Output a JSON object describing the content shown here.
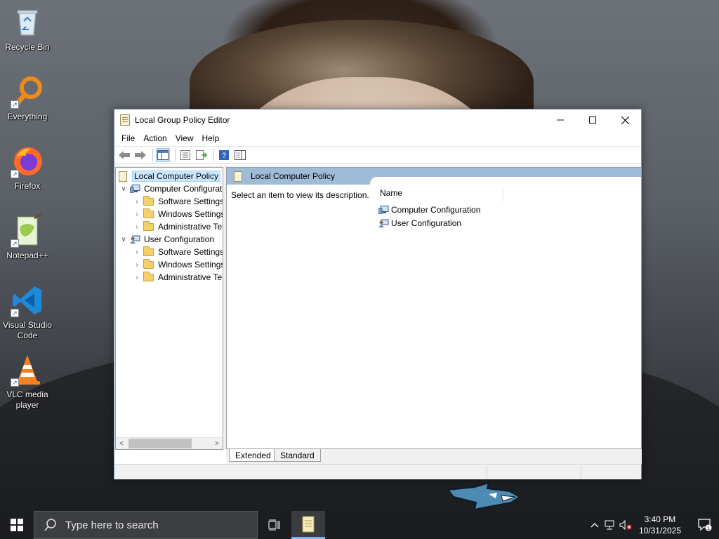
{
  "desktop": {
    "icons": [
      {
        "label": "Recycle Bin",
        "icon": "recycle-bin-icon"
      },
      {
        "label": "Everything",
        "icon": "everything-search-icon"
      },
      {
        "label": "Firefox",
        "icon": "firefox-icon"
      },
      {
        "label": "Notepad++",
        "icon": "notepad-plus-plus-icon"
      },
      {
        "label": "Visual Studio Code",
        "icon": "vscode-icon"
      },
      {
        "label": "VLC media player",
        "icon": "vlc-icon"
      }
    ]
  },
  "window": {
    "title": "Local Group Policy Editor",
    "menu": [
      "File",
      "Action",
      "View",
      "Help"
    ],
    "tree": {
      "root": "Local Computer Policy",
      "computer": "Computer Configuration",
      "computer_children": [
        "Software Settings",
        "Windows Settings",
        "Administrative Templates"
      ],
      "user": "User Configuration",
      "user_children": [
        "Software Settings",
        "Windows Settings",
        "Administrative Templates"
      ]
    },
    "right_pane": {
      "header": "Local Computer Policy",
      "description": "Select an item to view its description.",
      "column_name": "Name",
      "items": [
        "Computer Configuration",
        "User Configuration"
      ]
    },
    "tabs": [
      "Extended",
      "Standard"
    ],
    "active_tab": "Extended"
  },
  "taskbar": {
    "search_placeholder": "Type here to search",
    "time": "3:40 PM",
    "date": "10/31/2025",
    "notification_count": "1"
  },
  "colors": {
    "header_blue": "#9fbbd8",
    "selection": "#cce8ff",
    "taskbar": "#1b1d21"
  }
}
